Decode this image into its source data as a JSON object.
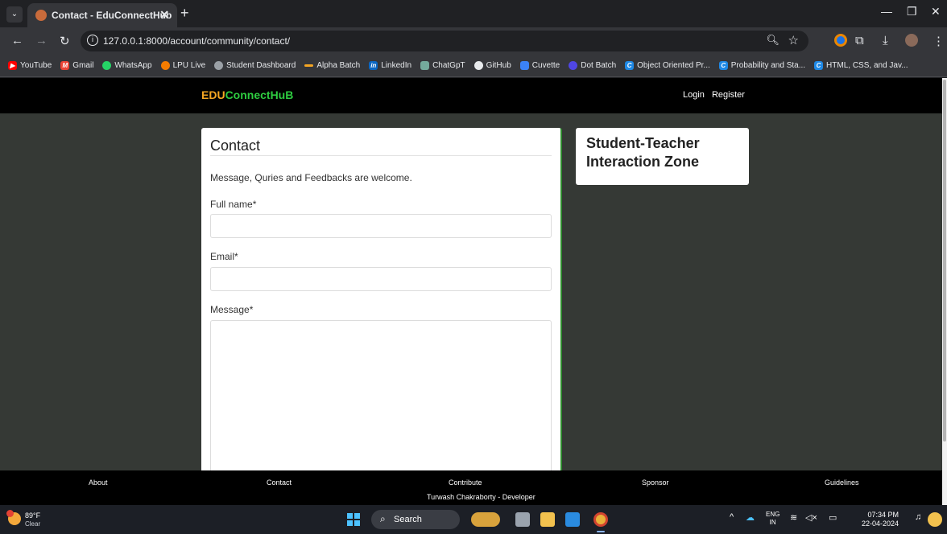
{
  "browser": {
    "tab_title": "Contact - EduConnectHub",
    "url": "127.0.0.1:8000/account/community/contact/",
    "bookmarks": [
      {
        "label": "YouTube",
        "color": "#ff0000"
      },
      {
        "label": "Gmail",
        "color": "#ea4335"
      },
      {
        "label": "WhatsApp",
        "color": "#25d366"
      },
      {
        "label": "LPU Live",
        "color": "#f57c00"
      },
      {
        "label": "Student Dashboard",
        "color": "#9aa0a6"
      },
      {
        "label": "Alpha Batch",
        "color": "#f5a623"
      },
      {
        "label": "LinkedIn",
        "color": "#0a66c2"
      },
      {
        "label": "ChatGpT",
        "color": "#74aa9c"
      },
      {
        "label": "GitHub",
        "color": "#e8eaed"
      },
      {
        "label": "Cuvette",
        "color": "#3b82f6"
      },
      {
        "label": "Dot Batch",
        "color": "#4f46e5"
      },
      {
        "label": "Object Oriented Pr...",
        "color": "#1e88e5"
      },
      {
        "label": "Probability and Sta...",
        "color": "#1e88e5"
      },
      {
        "label": "HTML, CSS, and Jav...",
        "color": "#1e88e5"
      }
    ]
  },
  "header": {
    "brand_part1": "EDU",
    "brand_part2": "ConnectHuB",
    "login": "Login",
    "register": "Register"
  },
  "form": {
    "title": "Contact",
    "intro": "Message, Quries and Feedbacks are welcome.",
    "full_name_label": "Full name*",
    "email_label": "Email*",
    "message_label": "Message*",
    "full_name_value": "",
    "email_value": "",
    "message_value": ""
  },
  "side": {
    "title": "Student-Teacher Interaction Zone"
  },
  "footer": {
    "links": [
      "About",
      "Contact",
      "Contribute",
      "Sponsor",
      "Guidelines"
    ],
    "developer": "Turwash Chakraborty - Developer"
  },
  "taskbar": {
    "temp": "89°F",
    "condition": "Clear",
    "search": "Search",
    "lang_top": "ENG",
    "lang_bottom": "IN",
    "time": "07:34 PM",
    "date": "22-04-2024"
  },
  "colors": {
    "brand_orange": "#f5a623",
    "brand_green": "#2ecc40",
    "page_bg": "#353935"
  }
}
